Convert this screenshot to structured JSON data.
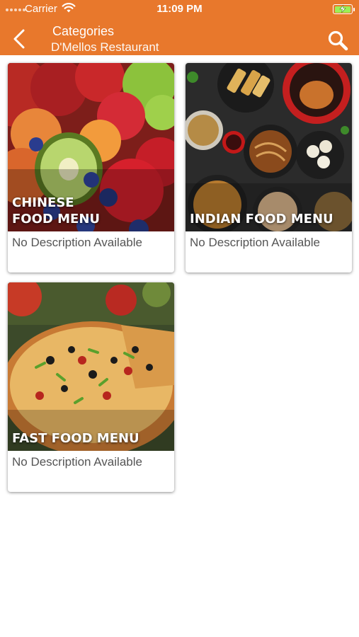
{
  "status_bar": {
    "carrier": "Carrier",
    "time": "11:09 PM",
    "charging": true
  },
  "nav": {
    "title": "Categories",
    "subtitle": "D'Mellos Restaurant",
    "back_icon": "chevron-left-icon",
    "search_icon": "search-icon"
  },
  "colors": {
    "header": "#e8782c",
    "header_text": "#ffffff",
    "description_text": "#555555",
    "battery": "#9cef56"
  },
  "categories": [
    {
      "title": "CHINESE\nFOOD  MENU",
      "description": "No Description Available",
      "image": "fruits-photo"
    },
    {
      "title": "INDIAN FOOD MENU",
      "description": "No Description Available",
      "image": "indian-dishes-photo"
    },
    {
      "title": "FAST FOOD MENU",
      "description": "No Description Available",
      "image": "pizza-photo"
    }
  ]
}
